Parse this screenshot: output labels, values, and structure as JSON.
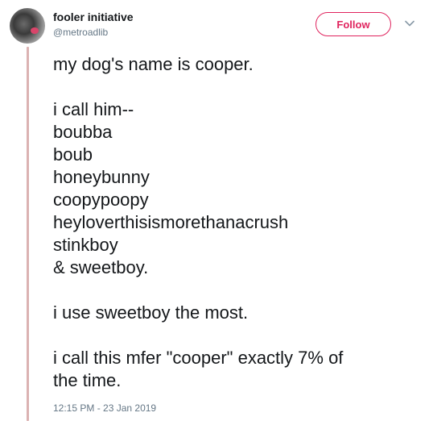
{
  "author": {
    "display_name": "fooler initiative",
    "handle": "@metroadlib",
    "avatar_icon": "avatar-photo"
  },
  "actions": {
    "follow_label": "Follow",
    "menu_icon": "chevron-down-icon"
  },
  "tweet": {
    "lines": [
      "my dog's name is cooper.",
      "",
      "i call him--",
      "boubba",
      "boub",
      "honeybunny",
      "coopypoopy",
      "heyloverthisismorethanacrush",
      "stinkboy",
      "& sweetboy.",
      "",
      "i use sweetboy the most.",
      "",
      "i call this mfer \"cooper\" exactly 7% of",
      "the time."
    ],
    "timestamp": "12:15 PM - 23 Jan 2019"
  },
  "colors": {
    "accent": "#e0245e",
    "thread_line": "#dbb2b2",
    "secondary_text": "#657786",
    "primary_text": "#14171a"
  }
}
